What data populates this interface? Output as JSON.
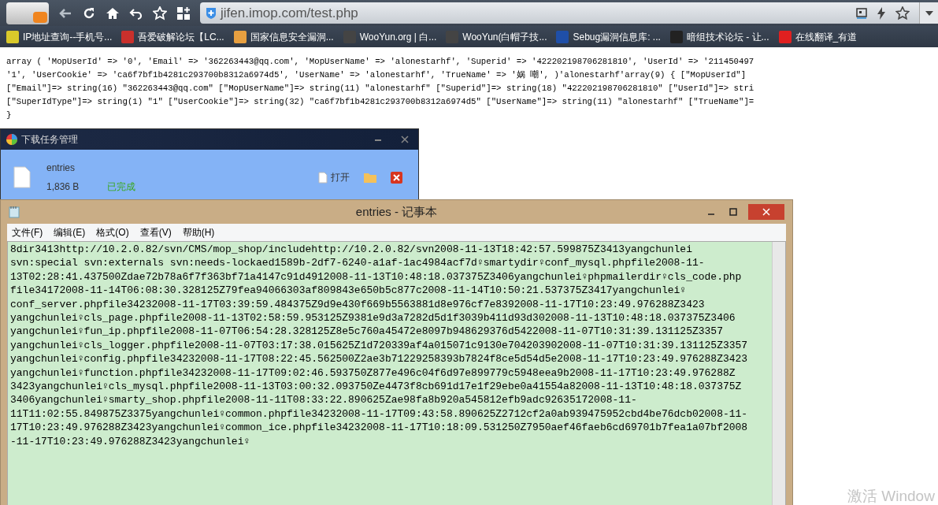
{
  "browser": {
    "url": "jifen.imop.com/test.php",
    "bookmarks": [
      "IP地址查询--手机号...",
      "吾爱破解论坛【LC...",
      "国家信息安全漏洞...",
      "WooYun.org | 白...",
      "WooYun(白帽子技...",
      "Sebug漏洞信息库: ...",
      "暗组技术论坛 - 让...",
      "在线翻译_有道"
    ]
  },
  "page_lines": [
    "array ( 'MopUserId' => '0', 'Email' => '362263443@qq.com', 'MopUserName' => 'alonestarhf', 'Superid' => '422202198706281810', 'UserId' => '211450497",
    "'1', 'UserCookie' => 'ca6f7bf1b4281c293700b8312a6974d5', 'UserName' => 'alonestarhf', 'TrueName' => '娲 嘲', )'alonestarhf'array(9) { [\"MopUserId\"]",
    "[\"Email\"]=> string(16) \"362263443@qq.com\" [\"MopUserName\"]=> string(11) \"alonestarhf\" [\"Superid\"]=> string(18) \"422202198706281810\" [\"UserId\"]=> stri",
    "[\"SuperIdType\"]=> string(1) \"1\" [\"UserCookie\"]=> string(32) \"ca6f7bf1b4281c293700b8312a6974d5\" [\"UserName\"]=> string(11) \"alonestarhf\" [\"TrueName\"]=",
    "}"
  ],
  "download_manager": {
    "title": "下载任务管理",
    "file_name": "entries",
    "file_size": "1,836 B",
    "status": "已完成",
    "open_button": "打开"
  },
  "notepad": {
    "title": "entries - 记事本",
    "menu": [
      "文件(F)",
      "编辑(E)",
      "格式(O)",
      "查看(V)",
      "帮助(H)"
    ],
    "lines": [
      "8dir3413http://10.2.0.82/svn/CMS/mop_shop/includehttp://10.2.0.82/svn2008-11-13T18:42:57.599875Z3413yangchunlei",
      "svn:special svn:externals svn:needs-lockaed1589b-2df7-6240-a1af-1ac4984acf7d♀smartydir♀conf_mysql.phpfile2008-11-",
      "13T02:28:41.437500Zdae72b78a6f7f363bf71a4147c91d4912008-11-13T10:48:18.037375Z3406yangchunlei♀phpmailerdir♀cls_code.php",
      "file34172008-11-14T06:08:30.328125Z79fea94066303af809843e650b5c877c2008-11-14T10:50:21.537375Z3417yangchunlei♀",
      "conf_server.phpfile34232008-11-17T03:39:59.484375Z9d9e430f669b5563881d8e976cf7e8392008-11-17T10:23:49.976288Z3423",
      "yangchunlei♀cls_page.phpfile2008-11-13T02:58:59.953125Z9381e9d3a7282d5d1f3039b411d93d302008-11-13T10:48:18.037375Z3406",
      "yangchunlei♀fun_ip.phpfile2008-11-07T06:54:28.328125Z8e5c760a45472e8097b948629376d5422008-11-07T10:31:39.131125Z3357",
      "yangchunlei♀cls_logger.phpfile2008-11-07T03:17:38.015625Z1d720339af4a015071c9130e704203902008-11-07T10:31:39.131125Z3357",
      "yangchunlei♀config.phpfile34232008-11-17T08:22:45.562500Z2ae3b71229258393b7824f8ce5d54d5e2008-11-17T10:23:49.976288Z3423",
      "yangchunlei♀function.phpfile34232008-11-17T09:02:46.593750Z877e496c04f6d97e899779c5948eea9b2008-11-17T10:23:49.976288Z",
      "3423yangchunlei♀cls_mysql.phpfile2008-11-13T03:00:32.093750Ze4473f8cb691d17e1f29ebe0a41554a82008-11-13T10:48:18.037375Z",
      "3406yangchunlei♀smarty_shop.phpfile2008-11-11T08:33:22.890625Zae98fa8b920a545812efb9adc92635172008-11-",
      "11T11:02:55.849875Z3375yangchunlei♀common.phpfile34232008-11-17T09:43:58.890625Z2712cf2a0ab939475952cbd4be76dcb02008-11-",
      "17T10:23:49.976288Z3423yangchunlei♀common_ice.phpfile34232008-11-17T10:18:09.531250Z7950aef46faeb6cd69701b7fea1a07bf2008",
      "-11-17T10:23:49.976288Z3423yangchunlei♀"
    ]
  },
  "activation_notice": "激活 Window"
}
